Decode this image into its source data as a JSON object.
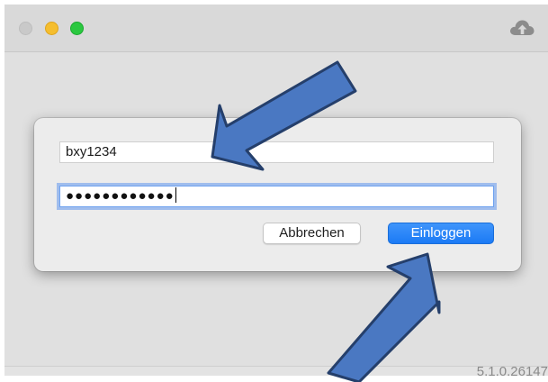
{
  "window": {
    "traffic_lights": [
      "close",
      "minimize",
      "zoom"
    ],
    "toolbar_icon": "cloud-upload-icon",
    "version": "5.1.0.26147"
  },
  "login_dialog": {
    "username_value": "bxy1234",
    "password_value": "●●●●●●●●●●●●",
    "cancel_label": "Abbrechen",
    "login_label": "Einloggen"
  },
  "annotations": {
    "arrow_color": "#4a78c2",
    "arrow_outline": "#253f6b",
    "items": [
      "arrow-to-username",
      "arrow-to-login-button"
    ]
  }
}
